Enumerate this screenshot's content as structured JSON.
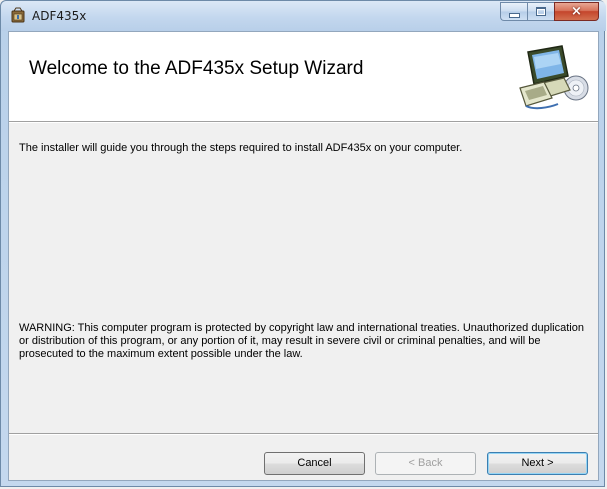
{
  "window": {
    "title": "ADF435x",
    "icon": "installer-icon",
    "controls": {
      "minimize": "minimize-icon",
      "maximize": "maximize-icon",
      "close": "×"
    }
  },
  "banner": {
    "title": "Welcome to the ADF435x Setup Wizard",
    "graphic": "computer-cd-icon"
  },
  "content": {
    "intro": "The installer will guide you through the steps required to install ADF435x on your computer.",
    "warning": "WARNING: This computer program is protected by copyright law and international treaties. Unauthorized duplication or distribution of this program, or any portion of it, may result in severe civil or criminal penalties, and will be prosecuted to the maximum extent possible under the law."
  },
  "buttons": {
    "cancel": "Cancel",
    "back": "< Back",
    "next": "Next >"
  }
}
